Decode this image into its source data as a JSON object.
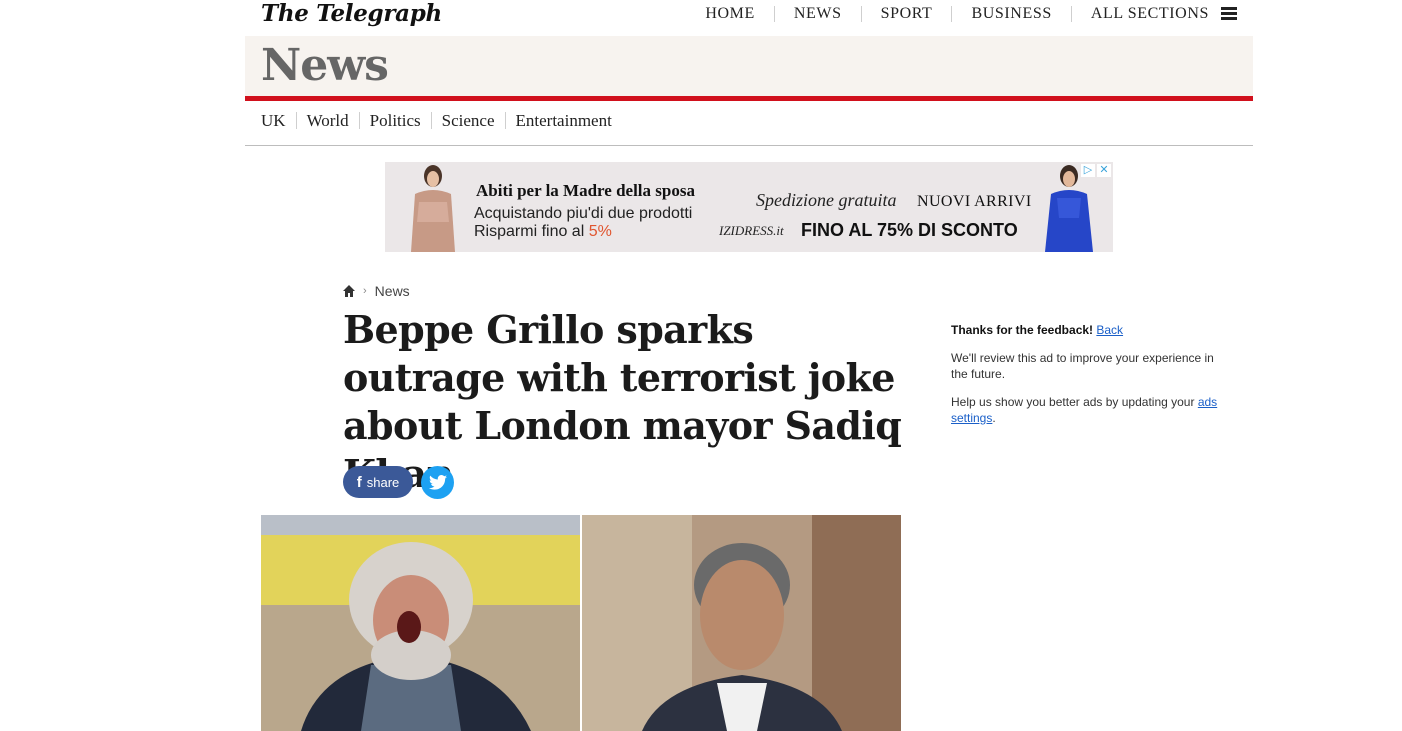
{
  "header": {
    "logo": "The Telegraph",
    "nav": [
      "HOME",
      "NEWS",
      "SPORT",
      "BUSINESS",
      "ALL SECTIONS"
    ]
  },
  "section": {
    "title": "News",
    "subnav": [
      "UK",
      "World",
      "Politics",
      "Science",
      "Entertainment"
    ]
  },
  "ad": {
    "line1": "Abiti per la Madre della sposa",
    "line2": "Acquistando piu'di due prodotti",
    "line3_prefix": "Risparmi fino al ",
    "line3_pct": "5%",
    "shipping": "Spedizione gratuita",
    "new_arrivals": "NUOVI ARRIVI",
    "brand": "IZIDRESS.it",
    "discount": "FINO AL 75% DI SCONTO"
  },
  "article": {
    "breadcrumb": "News",
    "headline": "Beppe Grillo sparks outrage with terrorist joke about London mayor Sadiq Khan",
    "share_label": "share"
  },
  "feedback": {
    "thanks": "Thanks for the feedback!",
    "back": "Back",
    "review": "We'll review this ad to improve your experience in the future.",
    "help_prefix": "Help us show you better ads by updating your ",
    "ads_settings": "ads settings",
    "help_suffix": "."
  },
  "colors": {
    "accent_red": "#d1101c",
    "facebook": "#3b5998",
    "twitter": "#1da1f2",
    "section_bg": "#f7f3ef"
  }
}
